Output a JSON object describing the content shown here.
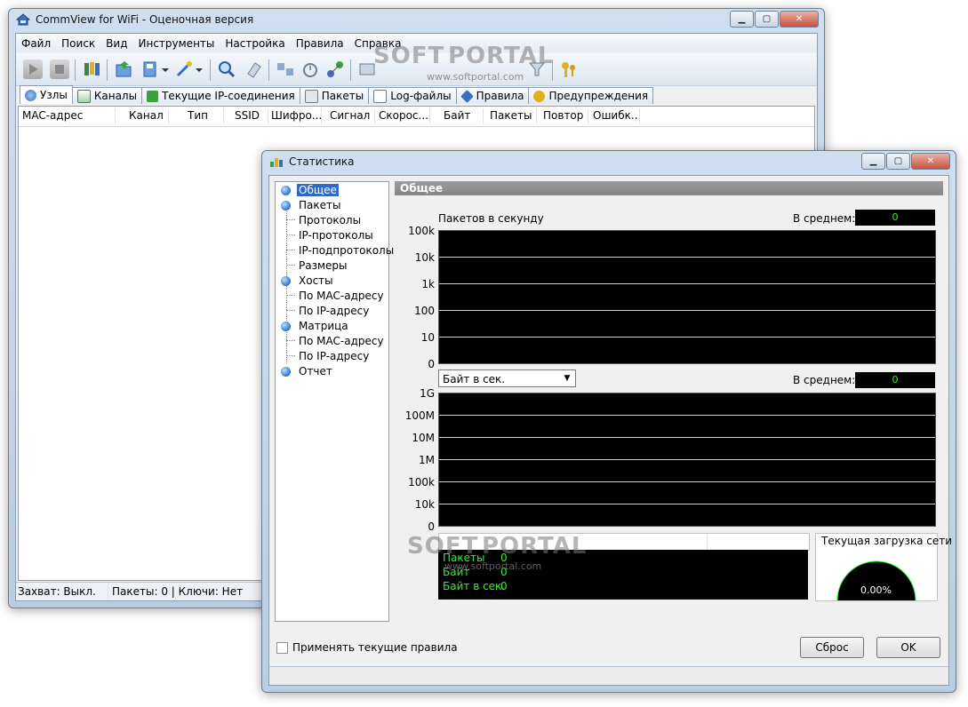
{
  "main_window": {
    "title": "CommView for WiFi - Оценочная версия",
    "menu": [
      "Файл",
      "Поиск",
      "Вид",
      "Инструменты",
      "Настройка",
      "Правила",
      "Справка"
    ],
    "tabs": [
      "Узлы",
      "Каналы",
      "Текущие IP-соединения",
      "Пакеты",
      "Log-файлы",
      "Правила",
      "Предупреждения"
    ],
    "columns": [
      "MAC-адрес",
      "Канал",
      "Тип",
      "SSID",
      "Шифро...",
      "Сигнал",
      "Скорос...",
      "Байт",
      "Пакеты",
      "Повтор",
      "Ошибк..."
    ],
    "status": {
      "capture": "Захват: Выкл.",
      "packets_keys": "Пакеты: 0 | Ключи: Нет"
    }
  },
  "stats_window": {
    "title": "Статистика",
    "tree": [
      "Общее",
      "Пакеты",
      "Протоколы",
      "IP-протоколы",
      "IP-подпротоколы",
      "Размеры",
      "Хосты",
      "По MAC-адресу",
      "По IP-адресу",
      "Матрица",
      "По MAC-адресу",
      "По IP-адресу",
      "Отчет"
    ],
    "section_title": "Общее",
    "pps": {
      "label": "Пакетов в секунду",
      "avg_label": "В среднем:",
      "avg_value": "0",
      "yticks": [
        "100k",
        "10k",
        "1k",
        "100",
        "10",
        "0"
      ]
    },
    "bps": {
      "combo_value": "Байт в сек.",
      "avg_label": "В среднем:",
      "avg_value": "0",
      "yticks": [
        "1G",
        "100M",
        "10M",
        "1M",
        "100k",
        "10k",
        "0"
      ]
    },
    "summary": {
      "packets_label": "Пакеты",
      "packets_value": "0",
      "bytes_label": "Байт",
      "bytes_value": "0",
      "bps_label": "Байт в сек.",
      "bps_value": "0"
    },
    "load": {
      "title": "Текущая загрузка сети",
      "value": "0.00%"
    },
    "apply_rules_label": "Применять текущие правила",
    "reset_label": "Сброс",
    "ok_label": "OK"
  },
  "watermark": {
    "brand_a": "SOFT",
    "brand_b": "PORTAL",
    "url": "www.softportal.com"
  },
  "colors": {
    "accent": "#3169c6",
    "graph_bg": "#000000",
    "graph_text": "#2ef02e"
  }
}
